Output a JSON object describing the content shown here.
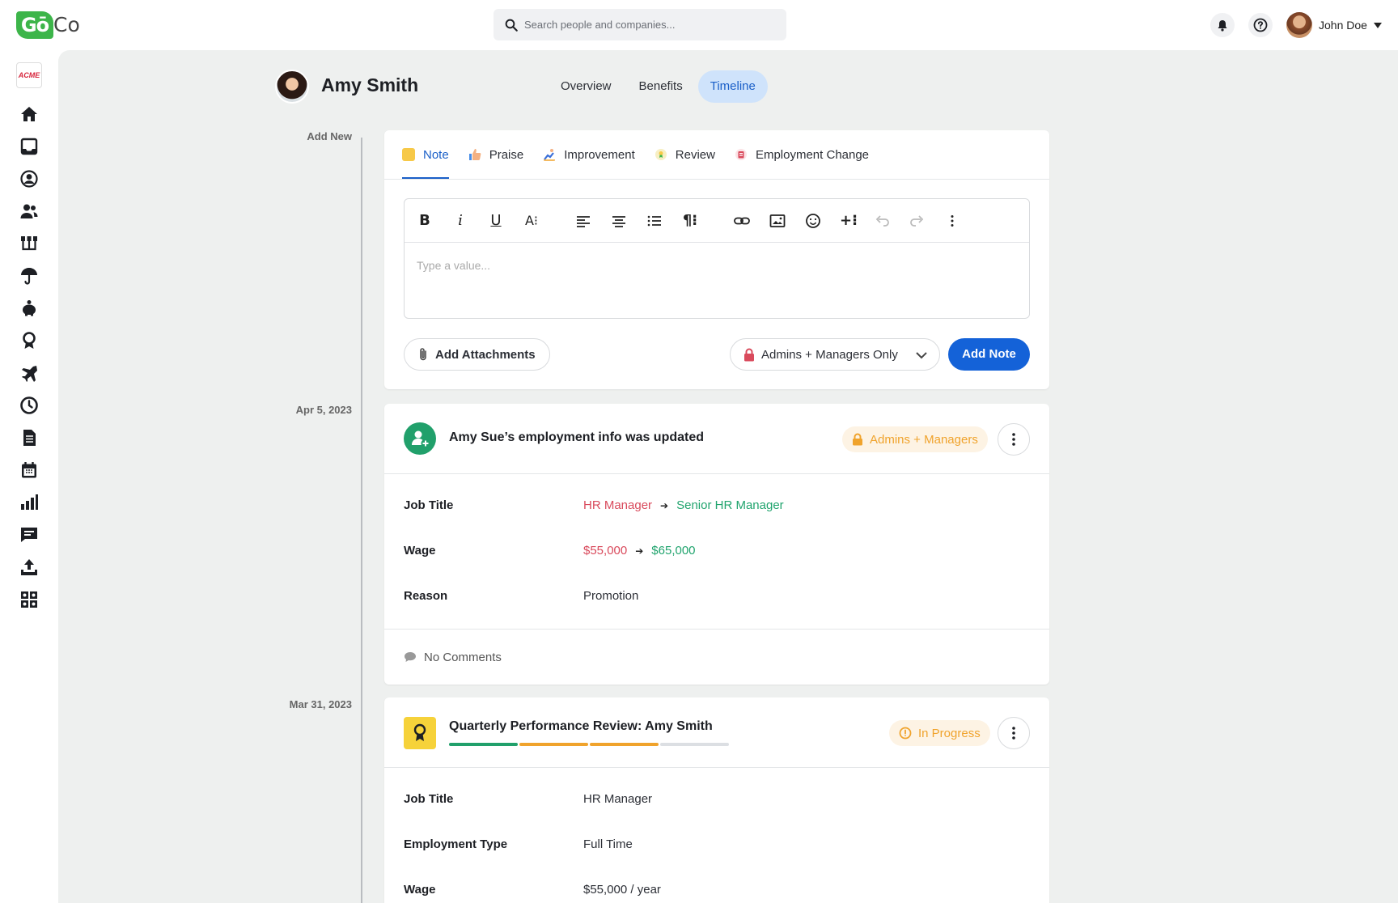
{
  "app": {
    "logo_go": "Gō",
    "logo_co": "Co",
    "company_logo": "ACME"
  },
  "search": {
    "placeholder": "Search people and companies..."
  },
  "topbar": {
    "user_name": "John Doe"
  },
  "sidebar": {
    "icons": [
      "home-icon",
      "inbox-icon",
      "profile-icon",
      "people-icon",
      "org-chart-icon",
      "benefits-umbrella-icon",
      "savings-icon",
      "award-icon",
      "travel-icon",
      "time-clock-icon",
      "document-icon",
      "calendar-icon",
      "reports-icon",
      "messages-icon",
      "upload-icon",
      "directory-icon"
    ]
  },
  "employee": {
    "name": "Amy Smith"
  },
  "page_tabs": [
    {
      "label": "Overview"
    },
    {
      "label": "Benefits"
    },
    {
      "label": "Timeline"
    }
  ],
  "page_tabs_active": "Timeline",
  "timeline": {
    "add_new": "Add New",
    "dates": [
      "Apr 5, 2023",
      "Mar 31, 2023"
    ]
  },
  "composer": {
    "tabs": [
      {
        "label": "Note"
      },
      {
        "label": "Praise"
      },
      {
        "label": "Improvement"
      },
      {
        "label": "Review"
      },
      {
        "label": "Employment Change"
      }
    ],
    "active_tab": "Note",
    "placeholder": "Type a value...",
    "attach_label": "Add Attachments",
    "visibility": "Admins + Managers Only",
    "submit_label": "Add Note"
  },
  "entries": [
    {
      "title": "Amy Sue’s employment info was updated",
      "badge": "Admins + Managers",
      "fields": {
        "job_title": {
          "label": "Job Title",
          "from": "HR Manager",
          "to": "Senior HR Manager"
        },
        "wage": {
          "label": "Wage",
          "from": "$55,000",
          "to": "$65,000"
        },
        "reason": {
          "label": "Reason",
          "value": "Promotion"
        }
      },
      "comments": "No Comments"
    },
    {
      "title": "Quarterly Performance Review: Amy Smith",
      "badge": "In Progress",
      "progress_segments": [
        "complete",
        "in-progress",
        "in-progress",
        "pending"
      ],
      "fields": {
        "job_title": {
          "label": "Job Title",
          "value": "HR Manager"
        },
        "employment_type": {
          "label": "Employment Type",
          "value": "Full Time"
        },
        "wage": {
          "label": "Wage",
          "value": "$55,000 / year"
        }
      }
    }
  ],
  "colors": {
    "accent": "#1462d8",
    "success": "#21a46e",
    "danger": "#d94a5c",
    "warning": "#f0a32c"
  }
}
